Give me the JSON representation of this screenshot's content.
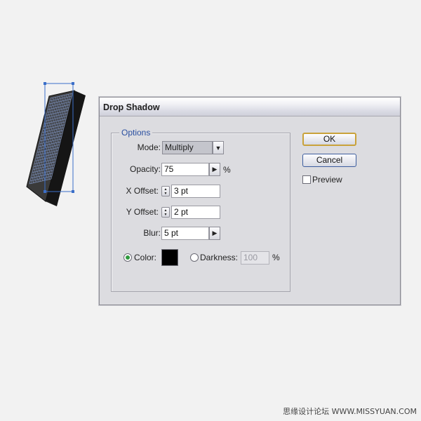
{
  "dialog": {
    "title": "Drop Shadow",
    "options_legend": "Options",
    "mode": {
      "label": "Mode:",
      "value": "Multiply"
    },
    "opacity": {
      "label": "Opacity:",
      "value": "75",
      "unit": "%"
    },
    "x_offset": {
      "label": "X Offset:",
      "value": "3 pt"
    },
    "y_offset": {
      "label": "Y Offset:",
      "value": "2 pt"
    },
    "blur": {
      "label": "Blur:",
      "value": "5 pt"
    },
    "color_option": {
      "label": "Color:",
      "selected": true,
      "swatch_color": "#000000"
    },
    "darkness_option": {
      "label": "Darkness:",
      "value": "100",
      "unit": "%",
      "selected": false
    },
    "buttons": {
      "ok": "OK",
      "cancel": "Cancel"
    },
    "preview": {
      "label": "Preview",
      "checked": false
    }
  },
  "colors": {
    "selection_handle": "#3b6fc9",
    "object_grid": "#7a8db5",
    "object_body": "#2c2c2c"
  },
  "watermark": "思缘设计论坛 WWW.MISSYUAN.COM"
}
